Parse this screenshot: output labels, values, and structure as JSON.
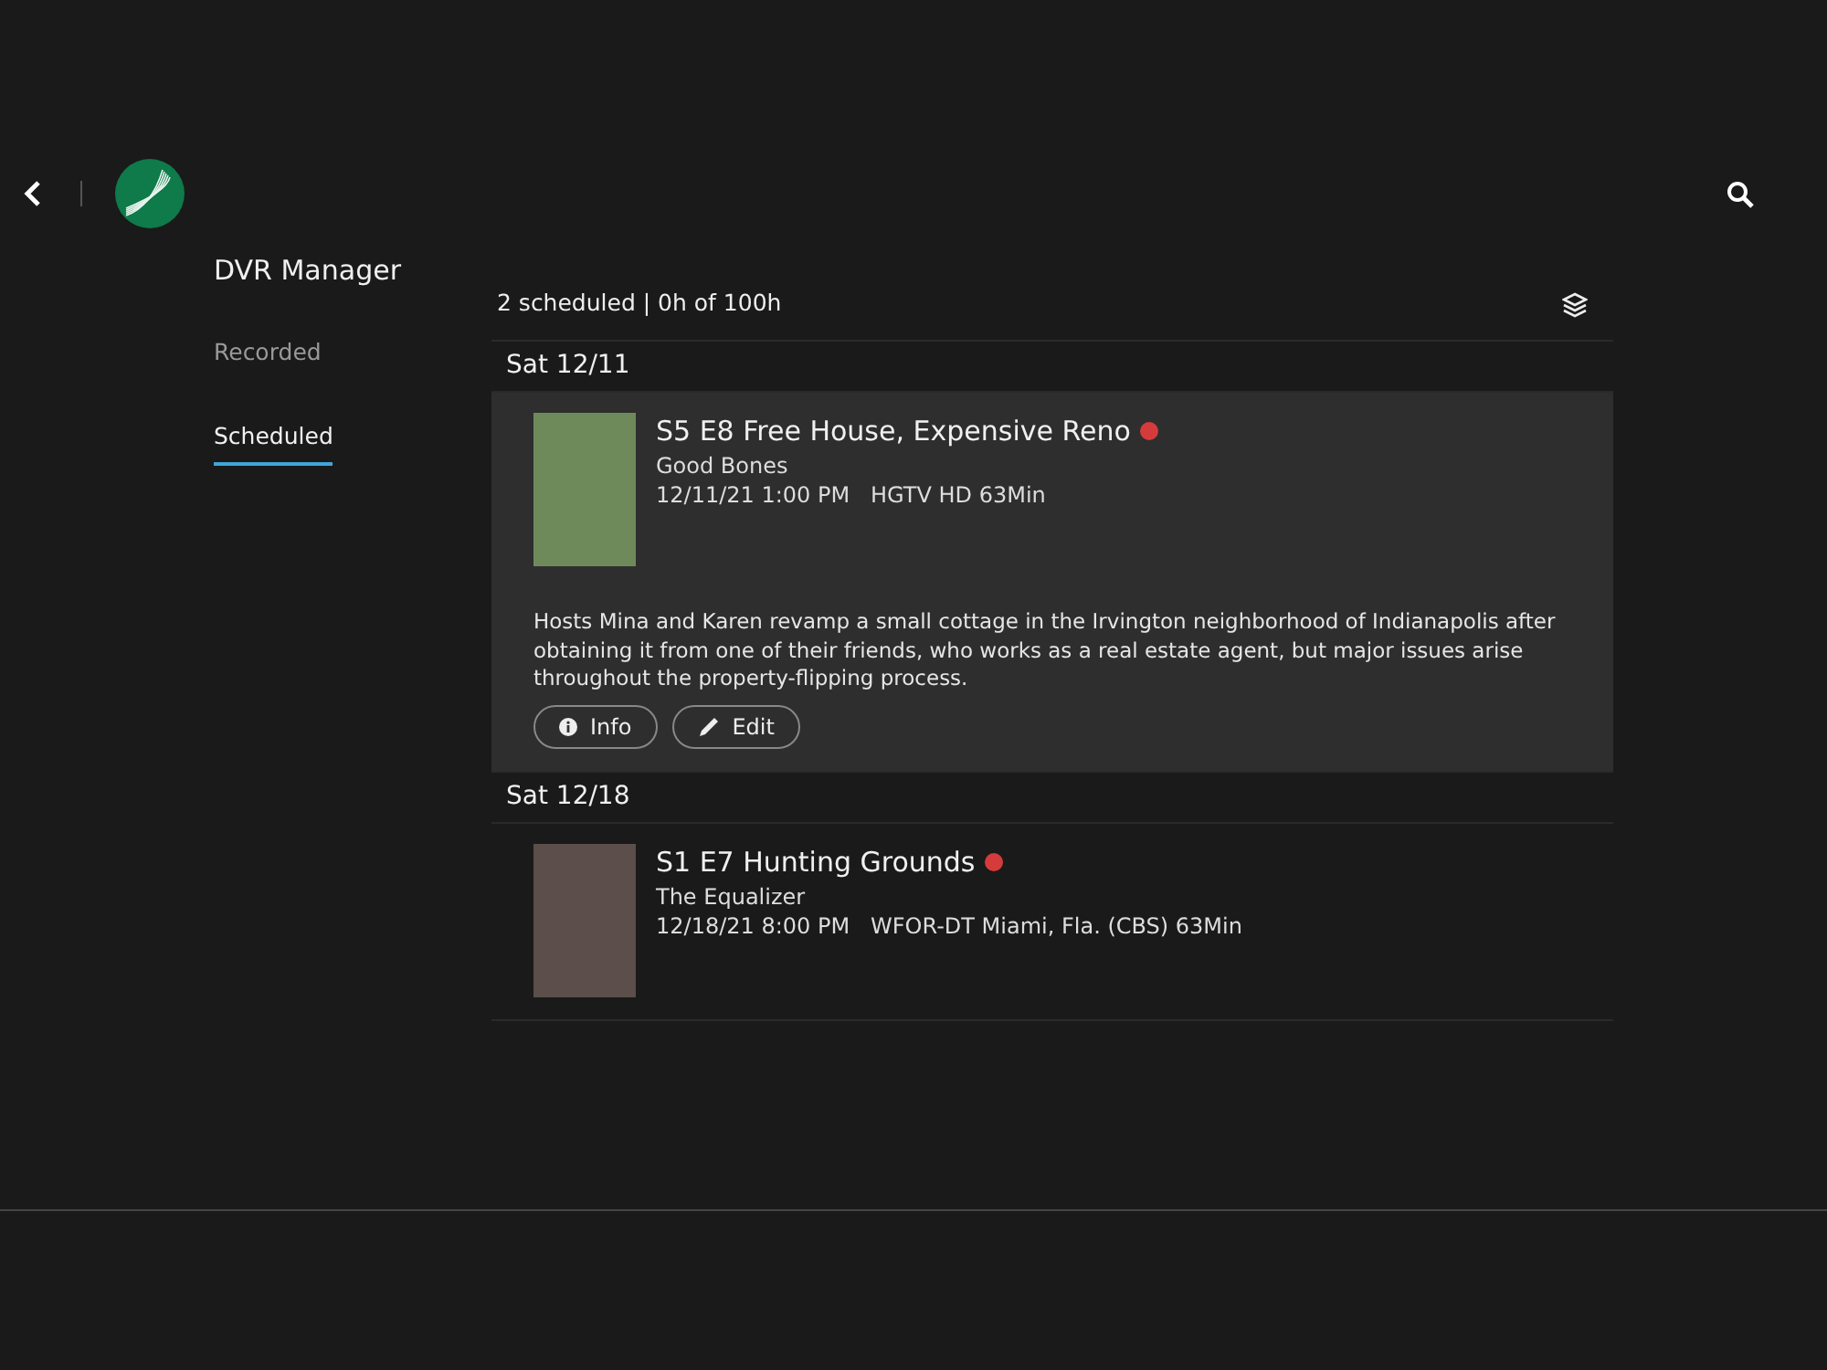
{
  "header": {
    "title": "DVR Manager"
  },
  "tabs": [
    {
      "label": "Recorded",
      "selected": false
    },
    {
      "label": "Scheduled",
      "selected": true
    }
  ],
  "summary": "2 scheduled | 0h of 100h",
  "groups": [
    {
      "date": "Sat 12/11",
      "items": [
        {
          "title": "S5 E8 Free House, Expensive Reno",
          "recording": true,
          "show": "Good Bones",
          "details": "12/11/21 1:00 PM   HGTV HD 63Min",
          "expanded": true,
          "description": "Hosts Mina and Karen revamp a small cottage in the Irvington neighborhood of Indianapolis after obtaining it from one of their friends, who works as a real estate agent, but major issues arise throughout the property-flipping process.",
          "buttons": [
            {
              "kind": "info",
              "label": "Info"
            },
            {
              "kind": "edit",
              "label": "Edit"
            }
          ]
        }
      ]
    },
    {
      "date": "Sat 12/18",
      "items": [
        {
          "title": "S1 E7 Hunting Grounds",
          "recording": true,
          "show": "The Equalizer",
          "details": "12/18/21 8:00 PM   WFOR-DT Miami, Fla. (CBS) 63Min",
          "expanded": false
        }
      ]
    }
  ]
}
